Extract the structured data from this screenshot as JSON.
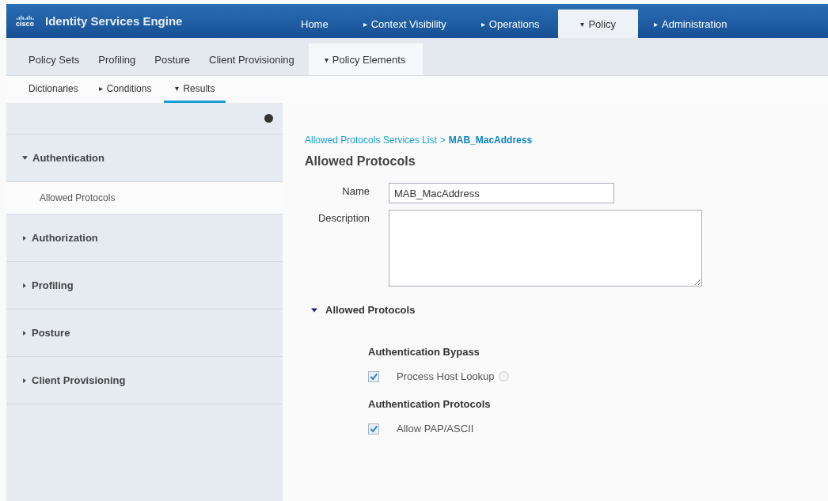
{
  "header": {
    "logo": "cisco",
    "title": "Identity Services Engine"
  },
  "main_tabs": [
    {
      "label": "Home",
      "selected": false
    },
    {
      "label": "Context Visibility",
      "caret": "▸",
      "selected": false
    },
    {
      "label": "Operations",
      "caret": "▸",
      "selected": false
    },
    {
      "label": "Policy",
      "caret": "▾",
      "selected": true
    },
    {
      "label": "Administration",
      "caret": "▸",
      "selected": false
    }
  ],
  "sub_tabs": [
    {
      "label": "Policy Sets",
      "selected": false
    },
    {
      "label": "Profiling",
      "selected": false
    },
    {
      "label": "Posture",
      "selected": false
    },
    {
      "label": "Client Provisioning",
      "selected": false
    },
    {
      "label": "Policy Elements",
      "caret": "▾",
      "selected": true
    }
  ],
  "third_tabs": [
    {
      "label": "Dictionaries",
      "selected": false
    },
    {
      "label": "Conditions",
      "caret": "▸",
      "selected": false
    },
    {
      "label": "Results",
      "caret": "▾",
      "selected": true
    }
  ],
  "sidebar": {
    "items": [
      {
        "label": "Authentication",
        "expanded": true,
        "children": [
          {
            "label": "Allowed Protocols",
            "selected": true
          }
        ]
      },
      {
        "label": "Authorization",
        "expanded": false
      },
      {
        "label": "Profiling",
        "expanded": false
      },
      {
        "label": "Posture",
        "expanded": false
      },
      {
        "label": "Client Provisioning",
        "expanded": false
      }
    ]
  },
  "breadcrumb": {
    "link": "Allowed Protocols Services List",
    "separator": ">",
    "current": "MAB_MacAddress"
  },
  "heading": "Allowed Protocols",
  "form": {
    "name_label": "Name",
    "name_value": "MAB_MacAddress",
    "description_label": "Description"
  },
  "section": {
    "title": "Allowed Protocols",
    "expanded": true,
    "groups": [
      {
        "title": "Authentication Bypass",
        "options": [
          {
            "label": "Process Host Lookup",
            "checked": true,
            "info": true
          }
        ]
      },
      {
        "title": "Authentication Protocols",
        "options": [
          {
            "label": "Allow PAP/ASCII",
            "checked": true,
            "info": false
          }
        ]
      }
    ]
  }
}
